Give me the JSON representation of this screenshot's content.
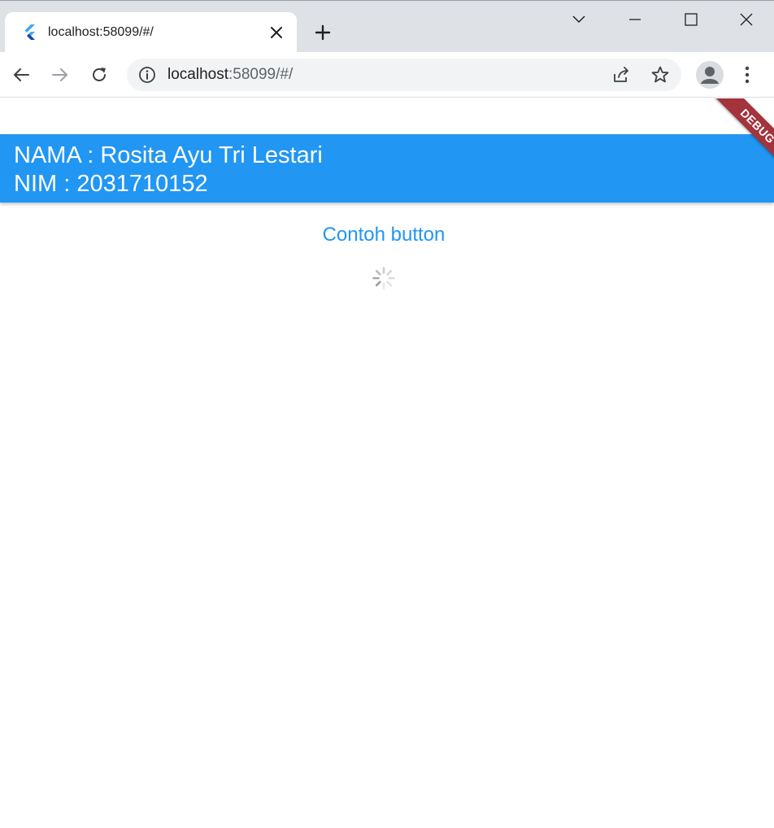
{
  "browser": {
    "tab": {
      "title": "localhost:58099/#/",
      "favicon": "flutter-icon"
    },
    "address_bar": {
      "host": "localhost",
      "path": ":58099/#/"
    },
    "icons": {
      "back": "arrow-left-icon",
      "forward": "arrow-right-icon",
      "reload": "reload-icon",
      "site_info": "info-icon",
      "share": "share-icon",
      "bookmark": "star-icon",
      "profile": "avatar-icon",
      "menu": "kebab-menu-icon",
      "tab_search": "chevron-down-icon",
      "minimize": "minimize-icon",
      "maximize": "maximize-icon",
      "close": "close-icon",
      "new_tab": "plus-icon"
    }
  },
  "app": {
    "appbar": {
      "line1": "NAMA : Rosita Ayu Tri Lestari",
      "line2": "NIM : 2031710152",
      "color": "#2196f3"
    },
    "button": {
      "label": "Contoh button",
      "color": "#2196f3"
    },
    "debug_banner": {
      "label": "DEBUG",
      "color": "#a3333c"
    }
  }
}
